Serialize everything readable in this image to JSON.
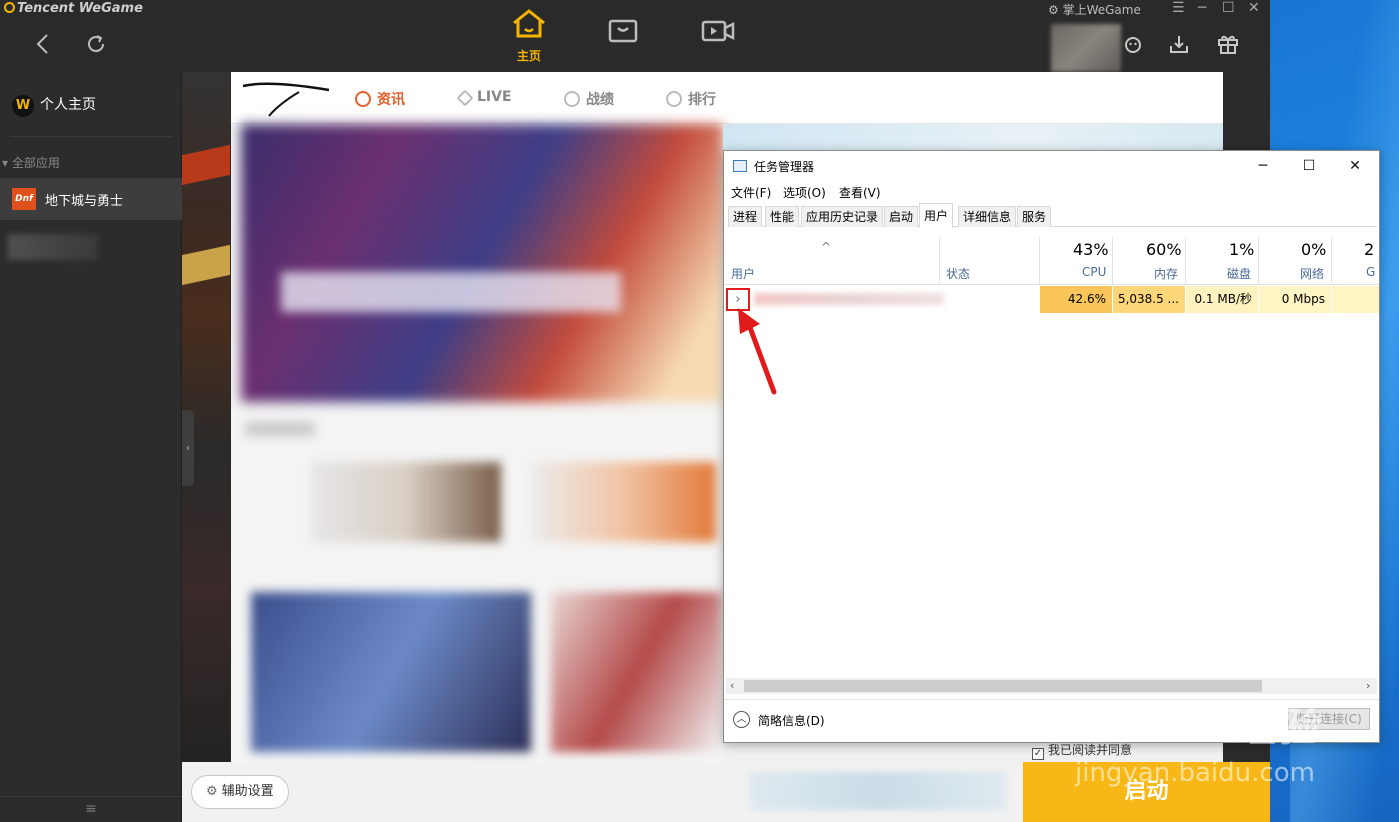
{
  "wegame": {
    "brand": "Tencent WeGame",
    "home_tab_label": "主页",
    "phone_label": "掌上WeGame",
    "window_controls": [
      "☰",
      "─",
      "☐",
      "✕"
    ],
    "sidebar": {
      "home_label": "个人主页",
      "home_badge": "W",
      "all_apps_label": "全部应用",
      "game_label": "地下城与勇士",
      "game_badge": "Dnf"
    },
    "main": {
      "logo_text": "DNF",
      "tabs": [
        {
          "label": "资讯",
          "active": true
        },
        {
          "label": "LIVE",
          "active": false
        },
        {
          "label": "战绩",
          "active": false
        },
        {
          "label": "排行",
          "active": false
        }
      ]
    },
    "bottom": {
      "assist_label": "辅助设置",
      "launch_label": "启动",
      "agree_label": "我已阅读并同意"
    }
  },
  "task_manager": {
    "title": "任务管理器",
    "controls": [
      "─",
      "☐",
      "✕"
    ],
    "menu": [
      "文件(F)",
      "选项(O)",
      "查看(V)"
    ],
    "tabs": [
      {
        "label": "进程",
        "active": false
      },
      {
        "label": "性能",
        "active": false
      },
      {
        "label": "应用历史记录",
        "active": false
      },
      {
        "label": "启动",
        "active": false
      },
      {
        "label": "用户",
        "active": true
      },
      {
        "label": "详细信息",
        "active": false
      },
      {
        "label": "服务",
        "active": false
      }
    ],
    "columns": {
      "user": "用户",
      "status": "状态",
      "cpu": {
        "pct": "43%",
        "label": "CPU"
      },
      "memory": {
        "pct": "60%",
        "label": "内存"
      },
      "disk": {
        "pct": "1%",
        "label": "磁盘"
      },
      "network": {
        "pct": "0%",
        "label": "网络"
      },
      "gpu": {
        "pct": "2",
        "label": "G"
      }
    },
    "row": {
      "expand_glyph": "›",
      "cpu": "42.6%",
      "memory": "5,038.5 ...",
      "disk": "0.1 MB/秒",
      "network": "0 Mbps"
    },
    "footer": {
      "fewer_details": "简略信息(D)",
      "disconnect": "断开连接(C)"
    }
  },
  "watermark": {
    "logo": "Bai du 经验",
    "url": "jingyan.baidu.com"
  },
  "colors": {
    "accent_yellow": "#f5b400",
    "launch_yellow": "#f7b817",
    "dnf_orange": "#e2602a",
    "annotation_red": "#e11b1b",
    "cpu_cell": "#fbc659",
    "memory_cell": "#fcd679",
    "disk_cell": "#fff2bf",
    "network_cell": "#fff4c4"
  }
}
